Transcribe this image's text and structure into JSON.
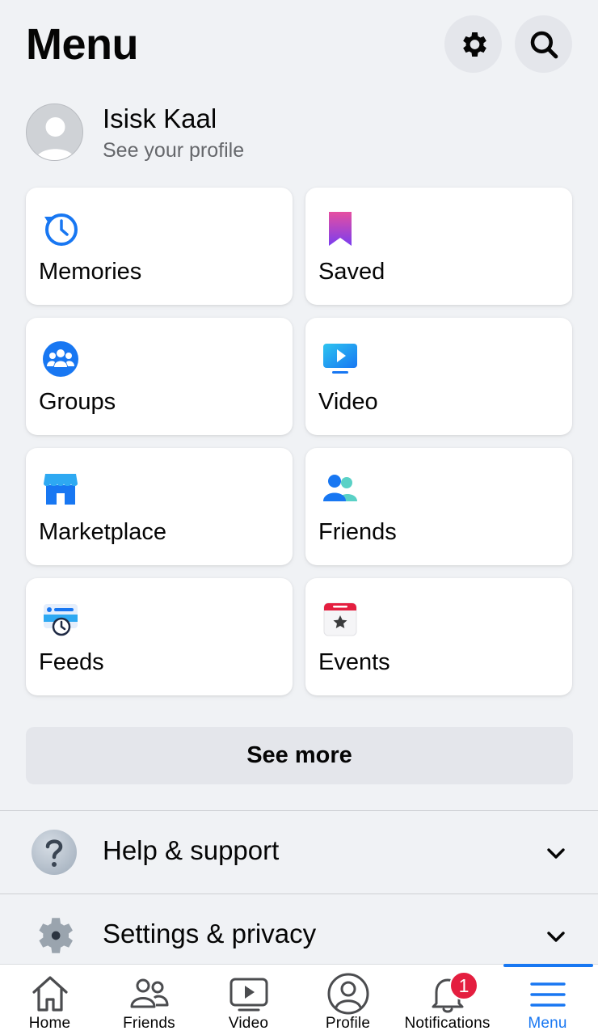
{
  "header": {
    "title": "Menu"
  },
  "profile": {
    "name": "Isisk Kaal",
    "subtitle": "See your profile"
  },
  "shortcuts": [
    {
      "label": "Memories",
      "icon": "memories-icon"
    },
    {
      "label": "Saved",
      "icon": "saved-icon"
    },
    {
      "label": "Groups",
      "icon": "groups-icon"
    },
    {
      "label": "Video",
      "icon": "video-icon"
    },
    {
      "label": "Marketplace",
      "icon": "marketplace-icon"
    },
    {
      "label": "Friends",
      "icon": "friends-icon"
    },
    {
      "label": "Feeds",
      "icon": "feeds-icon"
    },
    {
      "label": "Events",
      "icon": "events-icon"
    }
  ],
  "see_more": "See more",
  "sections": [
    {
      "label": "Help & support",
      "icon": "help-icon"
    },
    {
      "label": "Settings & privacy",
      "icon": "settings-gear-icon"
    }
  ],
  "bottom_nav": {
    "items": [
      {
        "label": "Home",
        "icon": "home-icon"
      },
      {
        "label": "Friends",
        "icon": "friends-outline-icon"
      },
      {
        "label": "Video",
        "icon": "video-outline-icon"
      },
      {
        "label": "Profile",
        "icon": "profile-icon"
      },
      {
        "label": "Notifications",
        "icon": "bell-icon"
      },
      {
        "label": "Menu",
        "icon": "hamburger-icon"
      }
    ],
    "active": "Menu",
    "notifications_badge": "1"
  },
  "colors": {
    "accent": "#1877f2",
    "background": "#f0f2f5",
    "badge": "#e41e3f"
  }
}
